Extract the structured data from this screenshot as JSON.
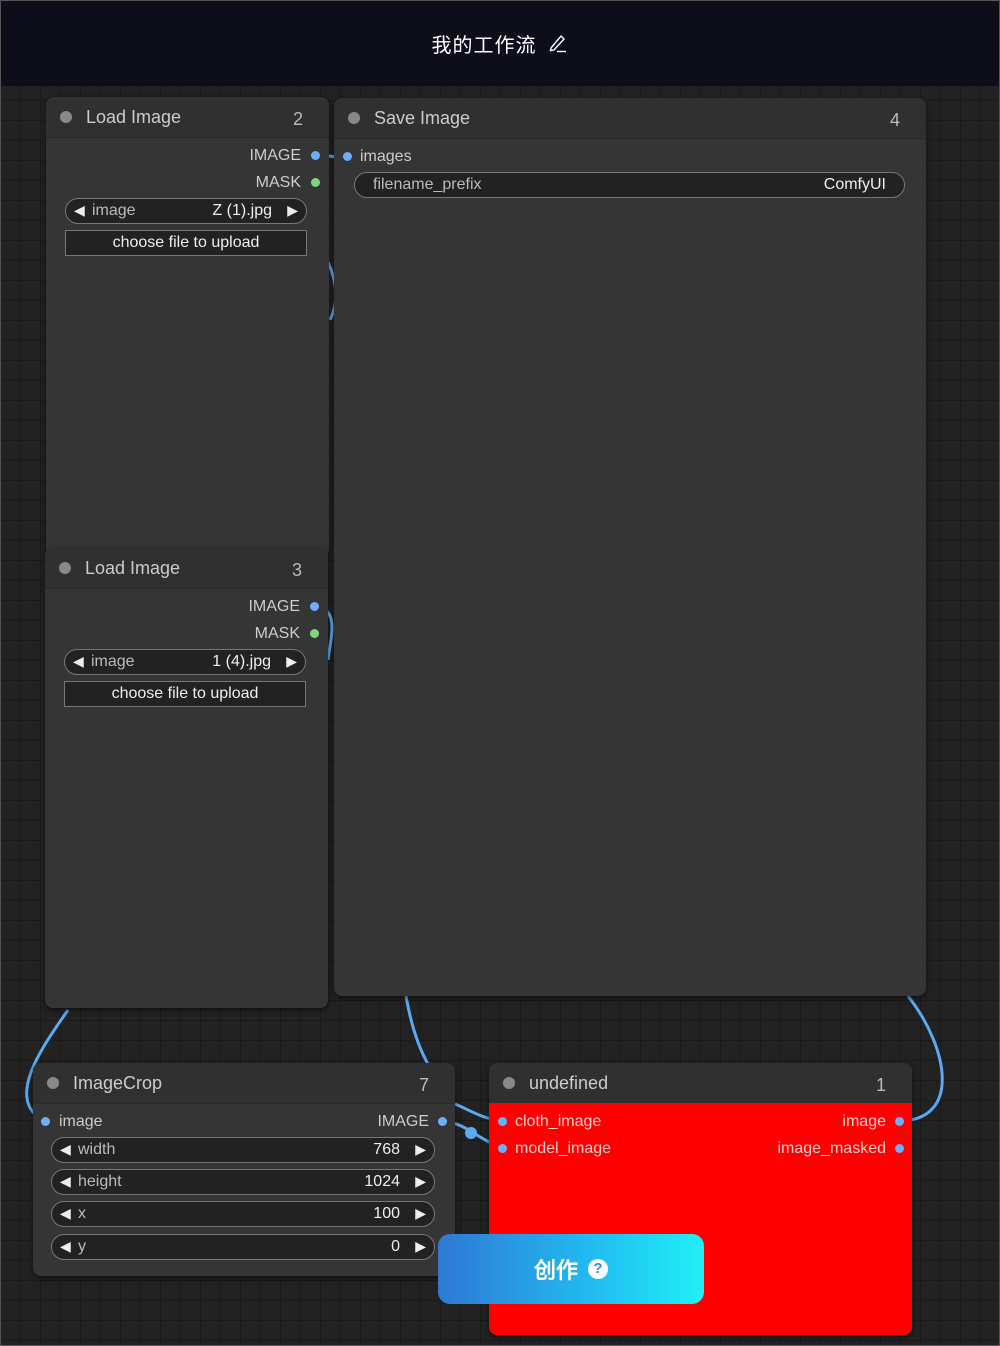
{
  "header": {
    "title": "我的工作流",
    "edit_icon": "pencil-icon"
  },
  "nodes": {
    "load_image_2": {
      "title": "Load Image",
      "id": "2",
      "outputs": [
        "IMAGE",
        "MASK"
      ],
      "image_label": "image",
      "image_value": "Z (1).jpg",
      "upload_label": "choose file to upload"
    },
    "load_image_3": {
      "title": "Load Image",
      "id": "3",
      "outputs": [
        "IMAGE",
        "MASK"
      ],
      "image_label": "image",
      "image_value": "1 (4).jpg",
      "upload_label": "choose file to upload"
    },
    "save_image_4": {
      "title": "Save Image",
      "id": "4",
      "inputs": [
        "images"
      ],
      "prefix_label": "filename_prefix",
      "prefix_value": "ComfyUI"
    },
    "image_crop_7": {
      "title": "ImageCrop",
      "id": "7",
      "input": "image",
      "output": "IMAGE",
      "widgets": [
        {
          "label": "width",
          "value": "768"
        },
        {
          "label": "height",
          "value": "1024"
        },
        {
          "label": "x",
          "value": "100"
        },
        {
          "label": "y",
          "value": "0"
        }
      ]
    },
    "undefined_1": {
      "title": "undefined",
      "id": "1",
      "inputs": [
        "cloth_image",
        "model_image"
      ],
      "outputs": [
        "image",
        "image_masked"
      ],
      "body_color": "#ff0000"
    }
  },
  "create_button": {
    "label": "创作",
    "help_icon": "?"
  },
  "colors": {
    "slot_image": "#6ab0ff",
    "slot_mask": "#7dd87d",
    "link": "#6ab0ff"
  }
}
